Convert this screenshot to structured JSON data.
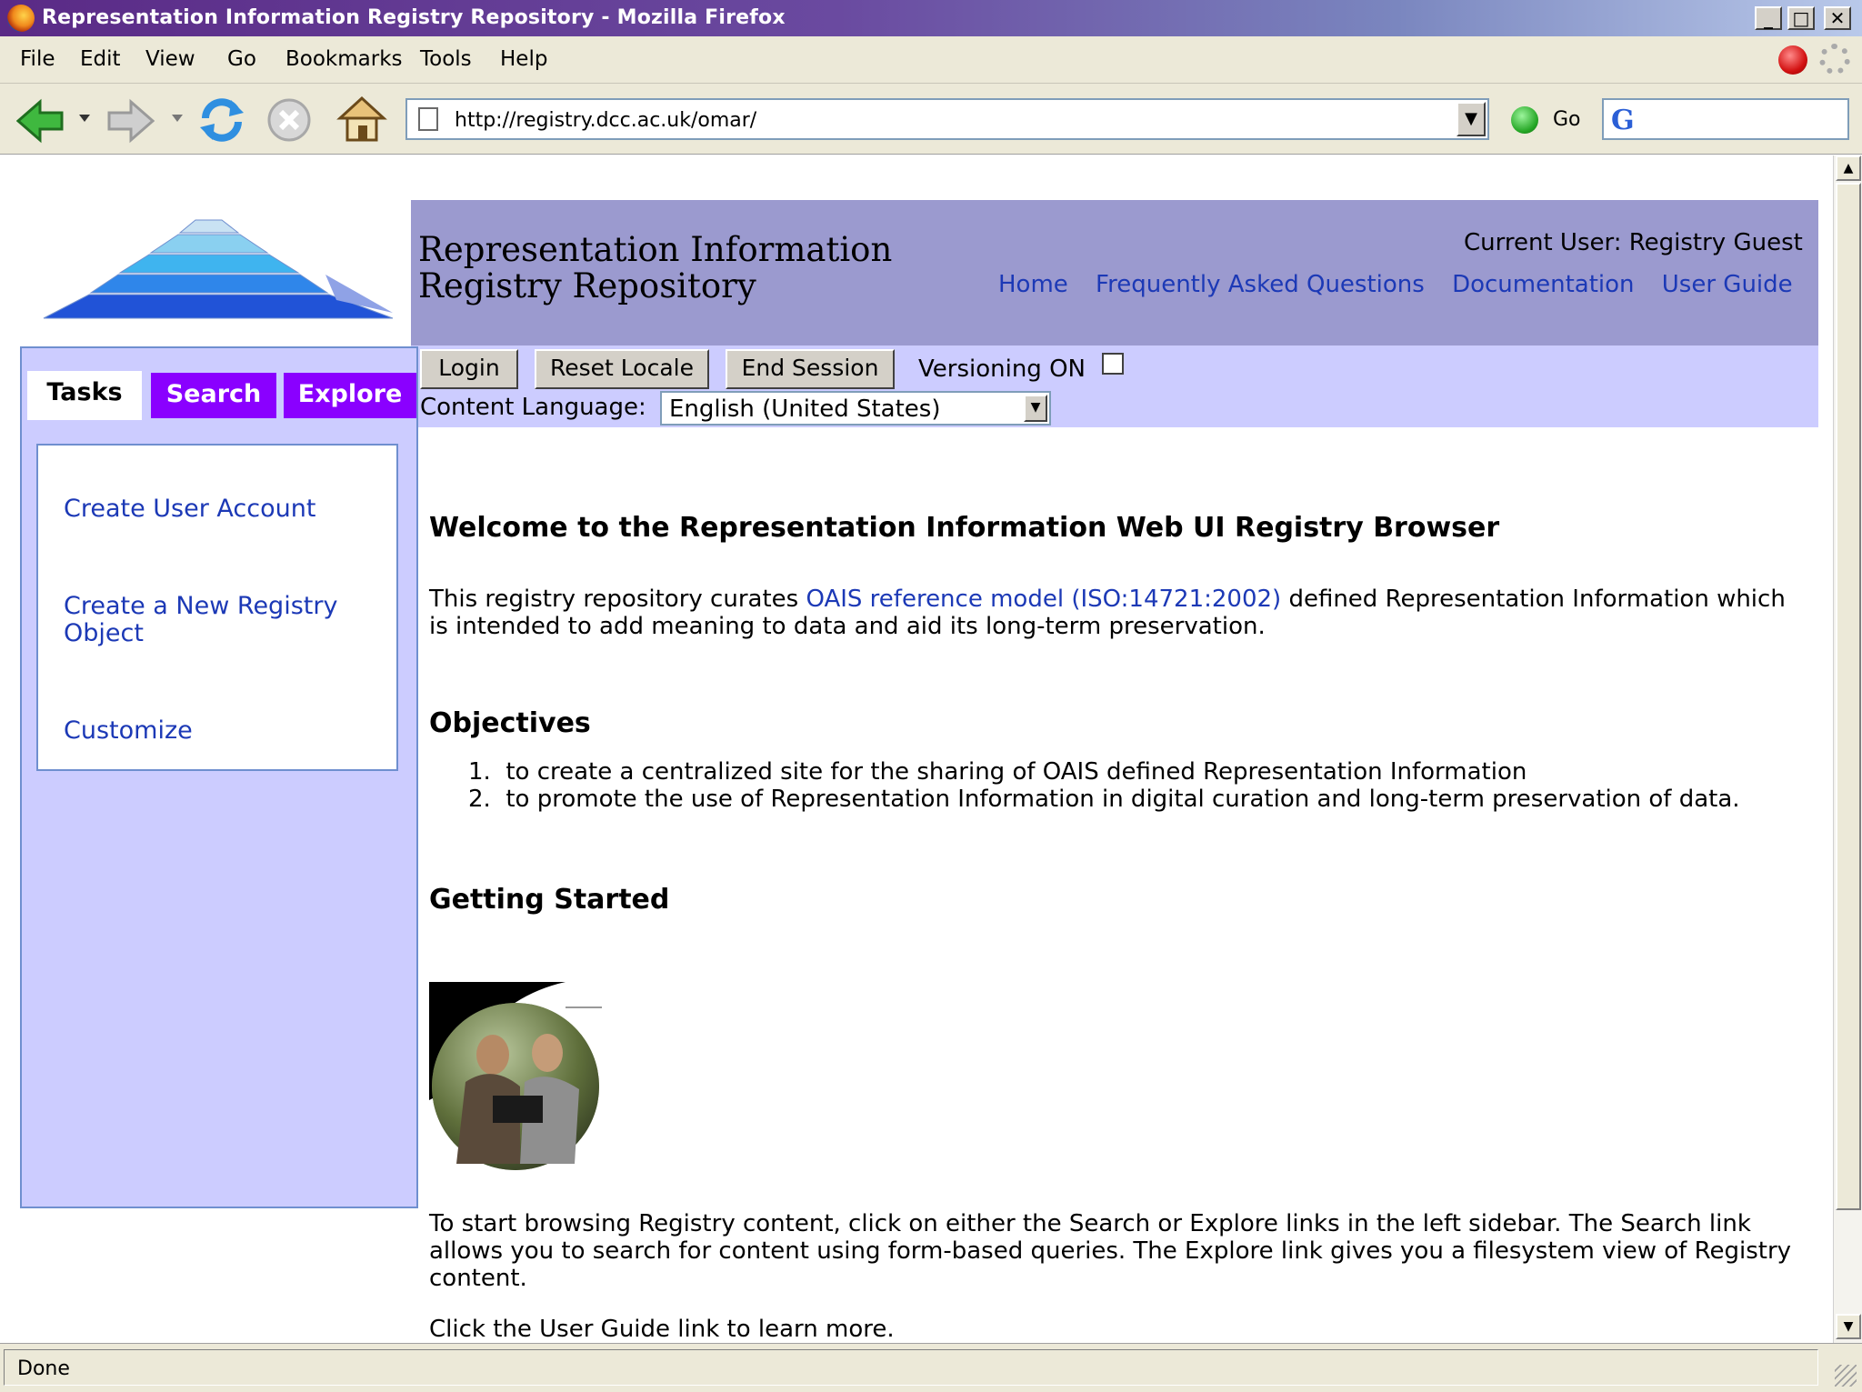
{
  "window": {
    "title": "Representation Information Registry Repository - Mozilla Firefox",
    "controls": [
      "minimize",
      "maximize",
      "close"
    ]
  },
  "menubar": {
    "items": [
      {
        "label": "File",
        "key": "F"
      },
      {
        "label": "Edit",
        "key": "E"
      },
      {
        "label": "View",
        "key": "V"
      },
      {
        "label": "Go",
        "key": "G"
      },
      {
        "label": "Bookmarks",
        "key": "B"
      },
      {
        "label": "Tools",
        "key": "T"
      },
      {
        "label": "Help",
        "key": "H"
      }
    ]
  },
  "toolbar": {
    "icons": [
      "back-icon",
      "forward-icon",
      "reload-icon",
      "stop-icon",
      "home-icon"
    ],
    "url": "http://registry.dcc.ac.uk/omar/",
    "go_label": "Go",
    "search_engine_icon": "google-icon"
  },
  "header": {
    "site_title_line1": "Representation Information",
    "site_title_line2": "Registry Repository",
    "current_user": "Current User: Registry Guest",
    "links": [
      "Home",
      "Frequently Asked Questions",
      "Documentation",
      "User Guide"
    ],
    "colors": {
      "banner": "#9b9acf",
      "action_bar": "#ccccff",
      "link": "#1c39b6",
      "tab": "#8a00ff"
    }
  },
  "actions": {
    "login": "Login",
    "reset_locale": "Reset Locale",
    "end_session": "End Session",
    "versioning_label": "Versioning ON",
    "versioning_checked": false,
    "content_language_label": "Content Language:",
    "content_language_value": "English (United States)"
  },
  "sidebar": {
    "tabs": [
      "Tasks",
      "Search",
      "Explore"
    ],
    "active_tab": "Tasks",
    "tasks": [
      "Create User Account",
      "Create a New Registry Object",
      "Customize"
    ]
  },
  "main": {
    "welcome_heading": "Welcome to the Representation Information Web UI Registry Browser",
    "intro_before": "This registry repository curates ",
    "intro_link": "OAIS reference model (ISO:14721:2002)",
    "intro_after": " defined Representation Information which is intended to add meaning to data and aid its long-term preservation.",
    "objectives_heading": "Objectives",
    "objectives": [
      {
        "num": "1.",
        "text": "to create a centralized site for the sharing of OAIS defined Representation Information"
      },
      {
        "num": "2.",
        "text": "to promote the use of Representation Information in digital curation and long-term preservation of data."
      }
    ],
    "getting_started_heading": "Getting Started",
    "getting_started_text": "To start browsing Registry content, click on either the Search or Explore links in the left sidebar. The Search link allows you to search for content using form-based queries. The Explore link gives you a filesystem view of Registry content.",
    "user_guide_text": "Click the User Guide link to learn more."
  },
  "status": {
    "text": "Done"
  }
}
